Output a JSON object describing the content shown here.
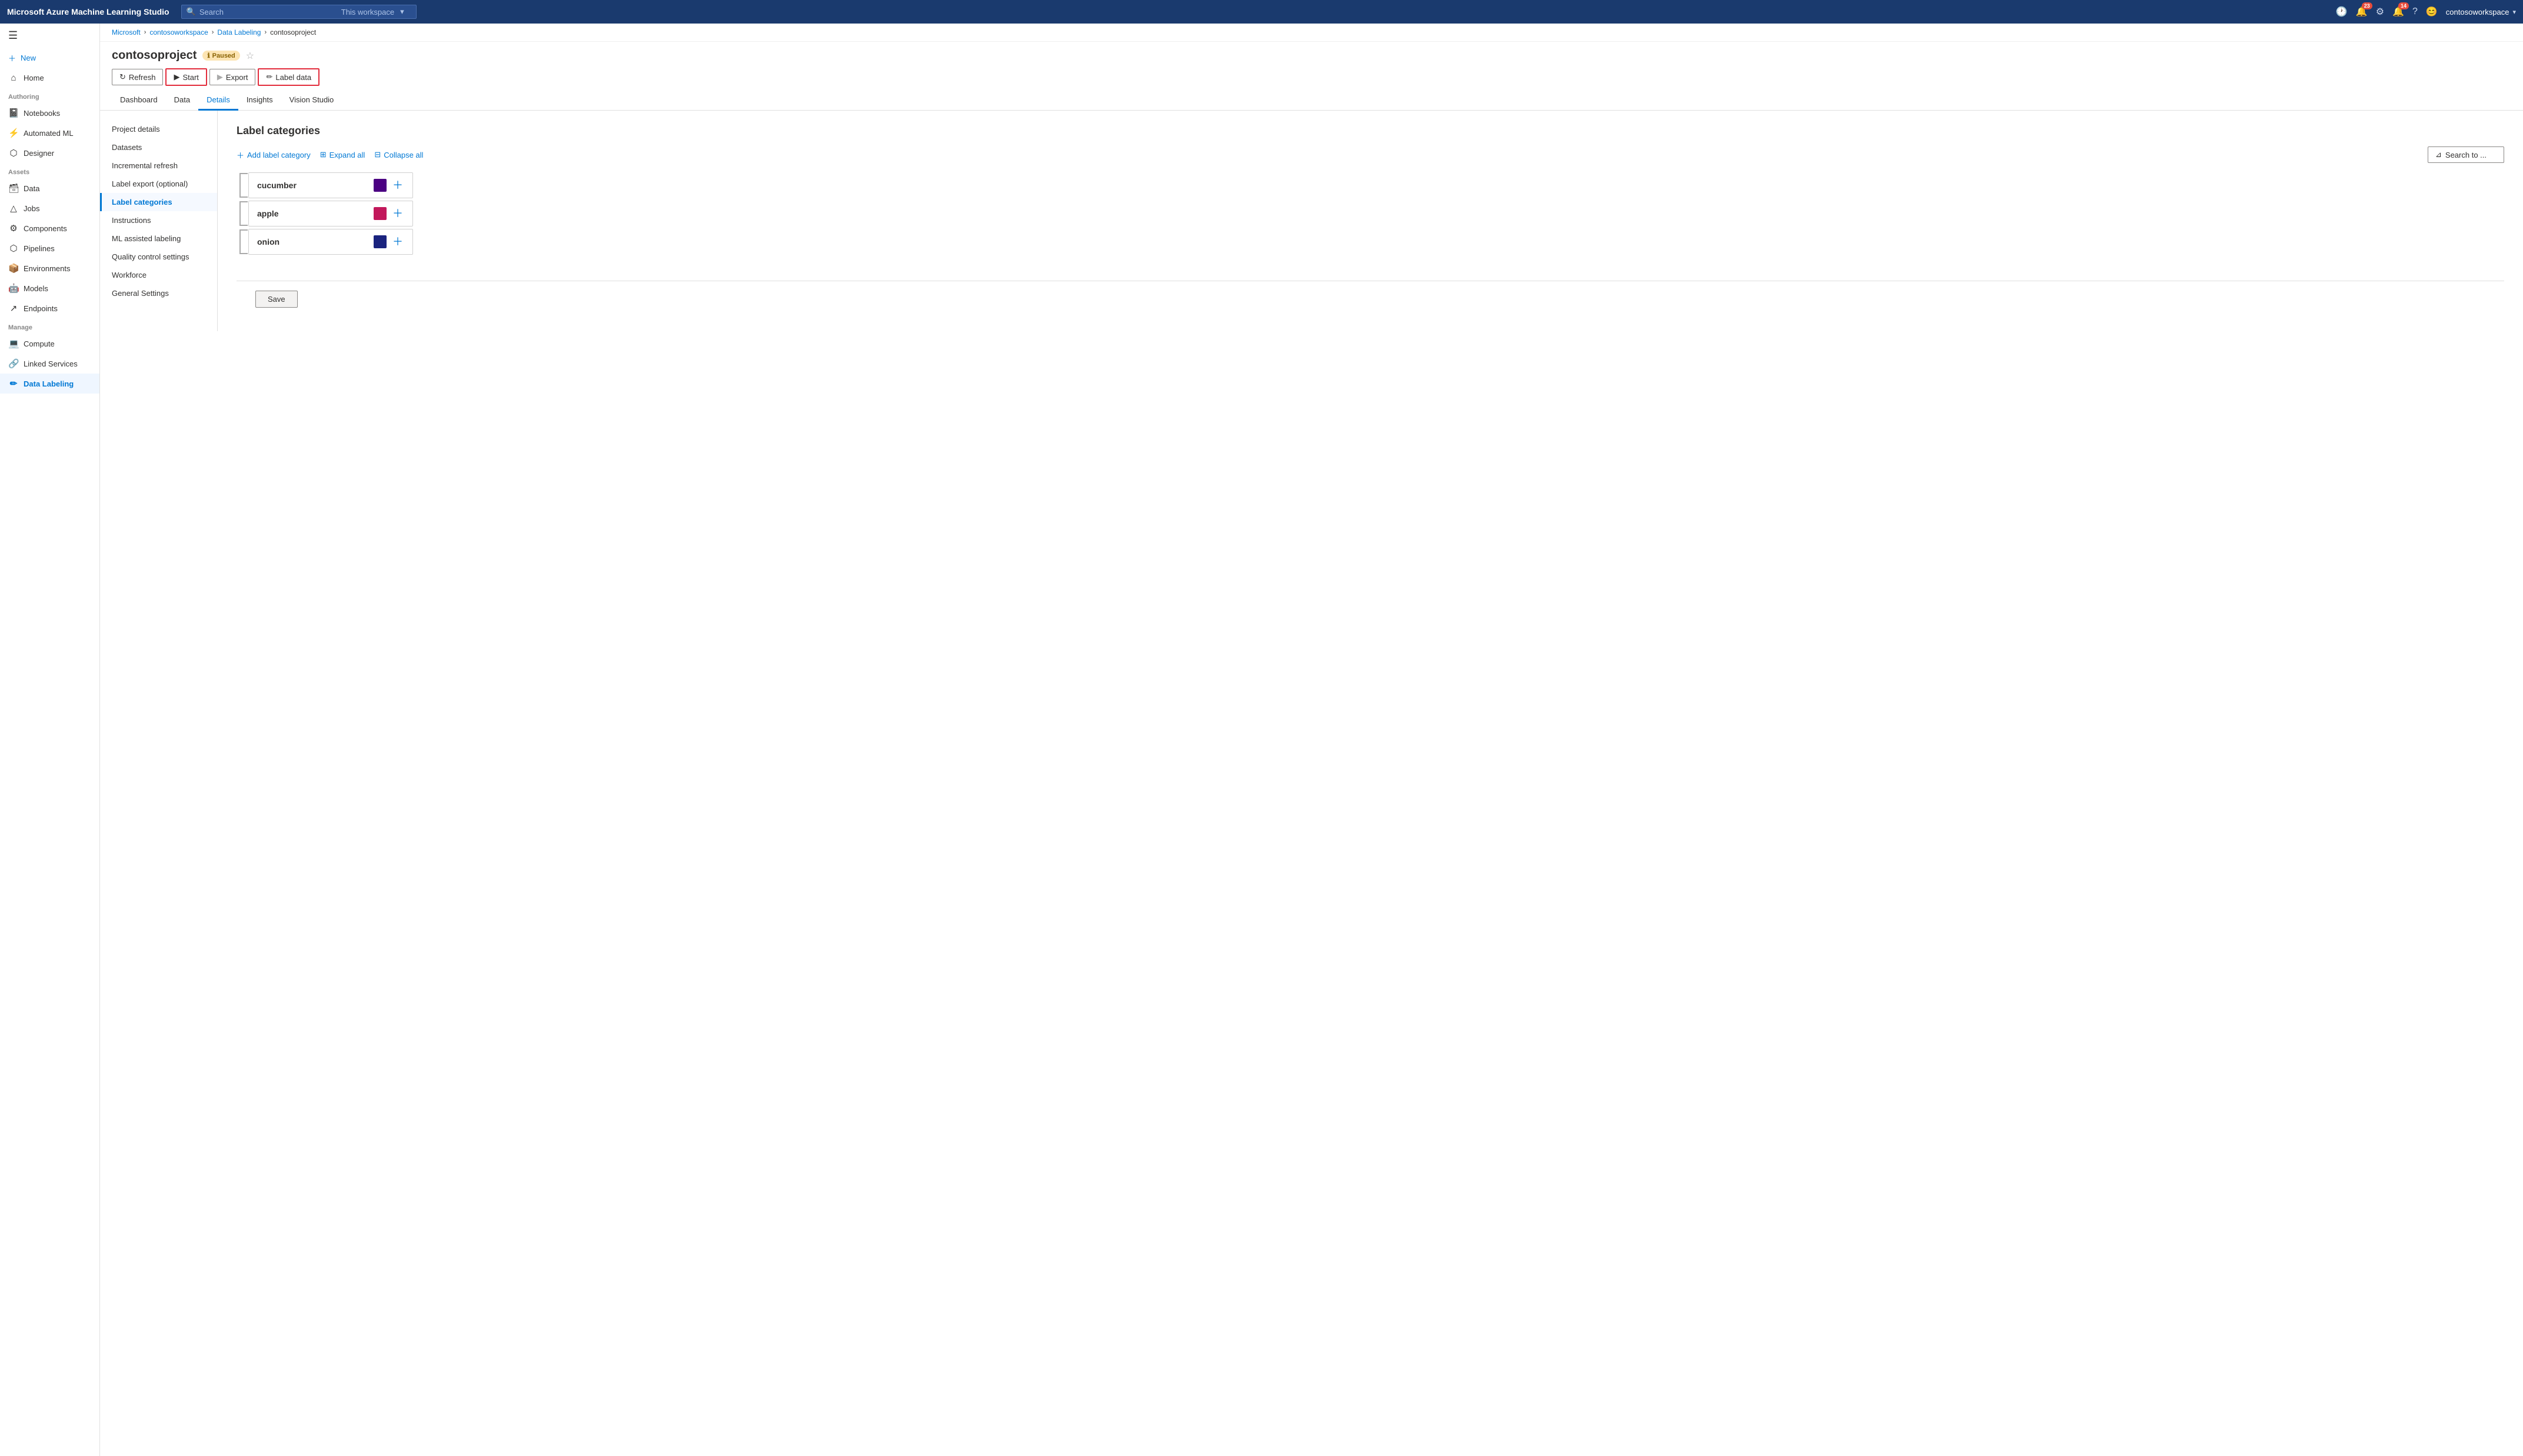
{
  "app": {
    "title": "Microsoft Azure Machine Learning Studio"
  },
  "topbar": {
    "search_placeholder": "Search",
    "workspace_label": "This workspace",
    "notifications_count": "23",
    "alerts_count": "14",
    "user_name": "contosoworkspace"
  },
  "breadcrumb": {
    "items": [
      "Microsoft",
      "contosoworkspace",
      "Data Labeling",
      "contosoproject"
    ]
  },
  "page": {
    "title": "contosoproject",
    "status": "Paused"
  },
  "toolbar": {
    "refresh_label": "Refresh",
    "start_label": "Start",
    "export_label": "Export",
    "label_data_label": "Label data"
  },
  "tabs": [
    {
      "id": "dashboard",
      "label": "Dashboard"
    },
    {
      "id": "data",
      "label": "Data"
    },
    {
      "id": "details",
      "label": "Details",
      "active": true
    },
    {
      "id": "insights",
      "label": "Insights"
    },
    {
      "id": "vision_studio",
      "label": "Vision Studio"
    }
  ],
  "left_nav": [
    {
      "id": "project_details",
      "label": "Project details"
    },
    {
      "id": "datasets",
      "label": "Datasets"
    },
    {
      "id": "incremental_refresh",
      "label": "Incremental refresh"
    },
    {
      "id": "label_export",
      "label": "Label export (optional)"
    },
    {
      "id": "label_categories",
      "label": "Label categories",
      "active": true
    },
    {
      "id": "instructions",
      "label": "Instructions"
    },
    {
      "id": "ml_assisted",
      "label": "ML assisted labeling"
    },
    {
      "id": "quality_control",
      "label": "Quality control settings"
    },
    {
      "id": "workforce",
      "label": "Workforce"
    },
    {
      "id": "general_settings",
      "label": "General Settings"
    }
  ],
  "label_categories": {
    "section_title": "Label categories",
    "add_label_btn": "Add label category",
    "expand_all_btn": "Expand all",
    "collapse_all_btn": "Collapse all",
    "search_placeholder": "Search to ...",
    "items": [
      {
        "id": "cucumber",
        "label": "cucumber",
        "color": "#4b0082"
      },
      {
        "id": "apple",
        "label": "apple",
        "color": "#c2185b"
      },
      {
        "id": "onion",
        "label": "onion",
        "color": "#1a237e"
      }
    ]
  },
  "save": {
    "label": "Save"
  },
  "sidebar": {
    "new_label": "New",
    "items": [
      {
        "id": "home",
        "label": "Home",
        "icon": "⌂"
      },
      {
        "id": "notebooks",
        "label": "Notebooks",
        "icon": "📓"
      },
      {
        "id": "automated_ml",
        "label": "Automated ML",
        "icon": "⚡"
      },
      {
        "id": "designer",
        "label": "Designer",
        "icon": "🔧"
      },
      {
        "id": "data",
        "label": "Data",
        "icon": "🗃"
      },
      {
        "id": "jobs",
        "label": "Jobs",
        "icon": "△"
      },
      {
        "id": "components",
        "label": "Components",
        "icon": "⚙"
      },
      {
        "id": "pipelines",
        "label": "Pipelines",
        "icon": "⬡"
      },
      {
        "id": "environments",
        "label": "Environments",
        "icon": "📦"
      },
      {
        "id": "models",
        "label": "Models",
        "icon": "🤖"
      },
      {
        "id": "endpoints",
        "label": "Endpoints",
        "icon": "↗"
      },
      {
        "id": "compute",
        "label": "Compute",
        "icon": "💻"
      },
      {
        "id": "linked_services",
        "label": "Linked Services",
        "icon": "🔗"
      },
      {
        "id": "data_labeling",
        "label": "Data Labeling",
        "icon": "✏",
        "active": true
      }
    ],
    "authoring_label": "Authoring",
    "assets_label": "Assets",
    "manage_label": "Manage"
  }
}
